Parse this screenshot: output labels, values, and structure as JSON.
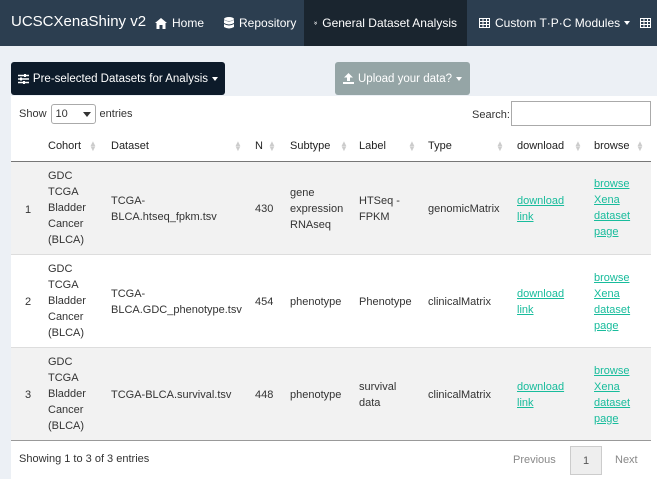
{
  "navbar": {
    "brand": "UCSCXenaShiny v2",
    "items": [
      {
        "label": "Home",
        "icon": "home-icon"
      },
      {
        "label": "Repository",
        "icon": "database-icon"
      },
      {
        "label": "General Dataset Analysis",
        "icon": "double-chevron-down-icon"
      },
      {
        "label": "Custom T·P·C Modules",
        "icon": "table-icon"
      },
      {
        "label": "",
        "icon": "table-icon"
      }
    ]
  },
  "buttons": {
    "preselected": "Pre-selected Datasets for Analysis",
    "upload": "Upload your data?"
  },
  "controls": {
    "show_label": "Show",
    "entries_value": "10",
    "entries_label": "entries",
    "search_label": "Search:",
    "search_value": ""
  },
  "table": {
    "columns": [
      "Cohort",
      "Dataset",
      "N",
      "Subtype",
      "Label",
      "Type",
      "download",
      "browse"
    ],
    "rows": [
      {
        "index": "1",
        "cohort": [
          "GDC",
          "TCGA",
          "Bladder",
          "Cancer",
          "(BLCA)"
        ],
        "dataset": [
          "TCGA-",
          "BLCA.htseq_fpkm.tsv"
        ],
        "n": "430",
        "subtype": [
          "gene",
          "expression",
          "RNAseq"
        ],
        "label": [
          "HTSeq -",
          "FPKM"
        ],
        "type": "genomicMatrix",
        "download": [
          "download",
          "link"
        ],
        "browse": [
          "browse",
          "Xena",
          "dataset",
          "page"
        ]
      },
      {
        "index": "2",
        "cohort": [
          "GDC",
          "TCGA",
          "Bladder",
          "Cancer",
          "(BLCA)"
        ],
        "dataset": [
          "TCGA-",
          "BLCA.GDC_phenotype.tsv"
        ],
        "n": "454",
        "subtype": [
          "phenotype"
        ],
        "label": [
          "Phenotype"
        ],
        "type": "clinicalMatrix",
        "download": [
          "download",
          "link"
        ],
        "browse": [
          "browse",
          "Xena",
          "dataset",
          "page"
        ]
      },
      {
        "index": "3",
        "cohort": [
          "GDC",
          "TCGA",
          "Bladder",
          "Cancer",
          "(BLCA)"
        ],
        "dataset": [
          "TCGA-BLCA.survival.tsv"
        ],
        "n": "448",
        "subtype": [
          "phenotype"
        ],
        "label": [
          "survival",
          "data"
        ],
        "type": "clinicalMatrix",
        "download": [
          "download",
          "link"
        ],
        "browse": [
          "browse",
          "Xena",
          "dataset",
          "page"
        ]
      }
    ]
  },
  "footer": {
    "info": "Showing 1 to 3 of 3 entries",
    "previous": "Previous",
    "page": "1",
    "next": "Next"
  },
  "colors": {
    "navbar": "#2c3e50",
    "accent_link": "#18bc9c",
    "dark_button": "#0d1b2a",
    "gray_button": "#95a5a6"
  }
}
